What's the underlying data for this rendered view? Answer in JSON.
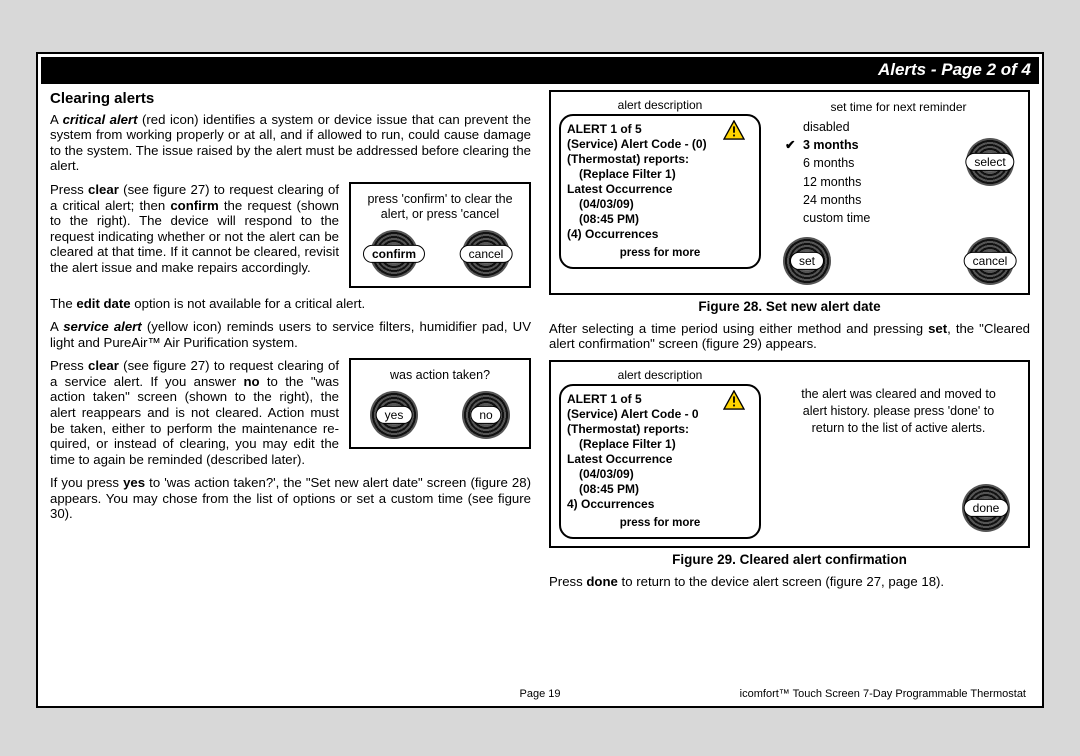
{
  "header": "Alerts - Page 2 of 4",
  "left": {
    "h2": "Clearing alerts",
    "p1_a": "A ",
    "p1_b": "critical alert",
    "p1_c": " (red icon) identifies a system or device issue that can pre­vent the system from working properly or at all, and if allowed to run, could cause damage to the system. The issue raised by the alert must be addressed before clearing the alert.",
    "p2_a": "Press ",
    "p2_b": "clear",
    "p2_c": " (see figure 27) to request clearing of a critical alert; then ",
    "p2_d": "confirm",
    "p2_e": " the request (shown to the right). The de­vice will respond to the request indicating whether or not the alert can be cleared at that time. If it cannot be cleared, revisit the alert issue and make repairs accord­ingly.",
    "mini1_prompt": "press 'confirm' to clear the alert, or press 'cancel",
    "mini1_btn1": "confirm",
    "mini1_btn2": "cancel",
    "p3_a": "The ",
    "p3_b": "edit date",
    "p3_c": " option is not available for a critical alert.",
    "p4_a": "A ",
    "p4_b": "service alert",
    "p4_c": " (yellow icon) reminds  users to service filters, humidifier pad, UV light and PureAir™ Air Purification system.",
    "p5_a": "Press ",
    "p5_b": "clear",
    "p5_c": " (see figure 27) to request clearing of a service alert. If you answer ",
    "p5_d": "no",
    "p5_e": " to the \"was action taken\" screen (shown to the right), the alert reappears and is not cleared. Action must be taken, either to perform the maintenance re­quired, or instead of clearing, you may edit the time to again be reminded (de­scribed later).",
    "mini2_prompt": "was action taken?",
    "mini2_btn1": "yes",
    "mini2_btn2": "no",
    "p6_a": "If you press ",
    "p6_b": "yes",
    "p6_c": " to 'was action taken?', the \"Set new alert date\" screen (figure 28) appears. You may chose from the list of options or set a cus­tom time (see figure 30)."
  },
  "fig28": {
    "label_left": "alert description",
    "label_right": "set time for next reminder",
    "alert_line1": "ALERT 1 of 5",
    "alert_line2": "(Service) Alert Code - (0)",
    "alert_line3": "(Thermostat) reports:",
    "alert_line4": "(Replace Filter 1)",
    "alert_line5": "Latest Occurrence",
    "alert_line6": "(04/03/09)",
    "alert_line7": "(08:45 PM)",
    "alert_line8": "(4) Occurrences",
    "press_more": "press for more",
    "options": [
      "disabled",
      "3 months",
      "6 months",
      "12 months",
      "24 months",
      "custom time"
    ],
    "selected_index": 1,
    "btn_select": "select",
    "btn_set": "set",
    "btn_cancel": "cancel",
    "caption": "Figure 28. Set new alert date"
  },
  "right": {
    "p1_a": "After selecting a time period using either method and pressing ",
    "p1_b": "set",
    "p1_c": ", the \"Cleared alert confirmation\" screen (figure 29) appears."
  },
  "fig29": {
    "label_left": "alert description",
    "msg": "the alert was cleared and moved to alert history. please press 'done' to return to the list of active alerts.",
    "btn_done": "done",
    "caption": "Figure 29. Cleared alert confirmation"
  },
  "right2_a": "Press ",
  "right2_b": "done",
  "right2_c": " to return to the device alert screen (figure 27, page 18).",
  "footer": {
    "page": "Page 19",
    "product": "icomfort™ Touch Screen 7-Day Programmable Thermostat"
  }
}
